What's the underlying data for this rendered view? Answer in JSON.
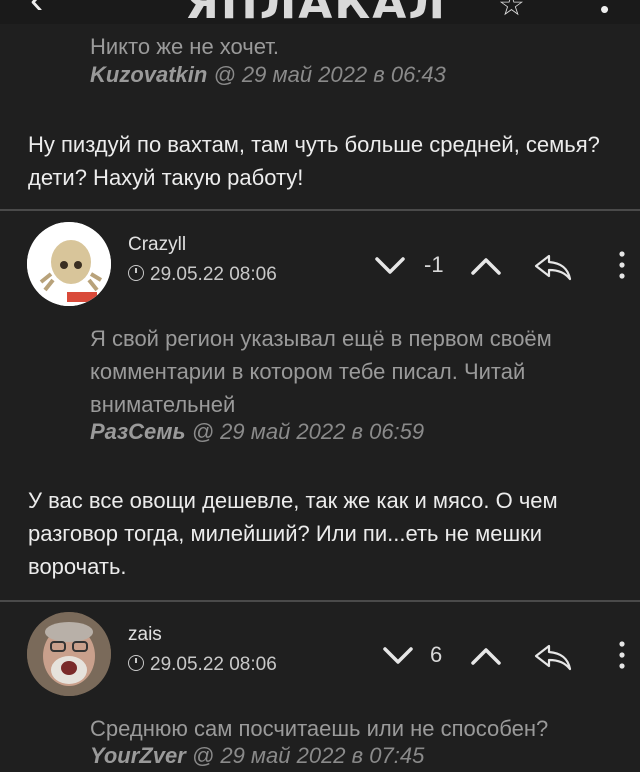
{
  "topbar": {
    "logo": "ЯПЛАКАЛ"
  },
  "quote1": {
    "text_tail": "Никто же не хочет.",
    "author": "Kuzovatkin",
    "date": "@ 29 май 2022 в 06:43"
  },
  "reply1": {
    "text": "Ну пиздуй по вахтам, там чуть больше средней, семья? дети? Нахуй такую работу!"
  },
  "comment1": {
    "username": "Crazyll",
    "timestamp": "29.05.22 08:06",
    "rating": "-1",
    "quote_text": "Я свой регион указывал ещё в первом своём комментарии в котором тебе писал. Читай внимательней",
    "quote_author": "РазСемь",
    "quote_date": "@ 29 май 2022 в 06:59",
    "text": "У вас все овощи дешевле, так же как и мясо. О чем разговор тогда, милейший? Или пи...еть не мешки ворочать."
  },
  "comment2": {
    "username": "zais",
    "timestamp": "29.05.22 08:06",
    "rating": "6",
    "quote_text": "Среднюю сам посчитаешь или не способен?",
    "quote_author": "YourZver",
    "quote_date": "@ 29 май 2022 в 07:45"
  },
  "icons": [
    "back-arrow-icon",
    "star-icon",
    "more-vertical-icon",
    "chevron-down-icon",
    "chevron-up-icon",
    "reply-icon",
    "clock-icon"
  ]
}
